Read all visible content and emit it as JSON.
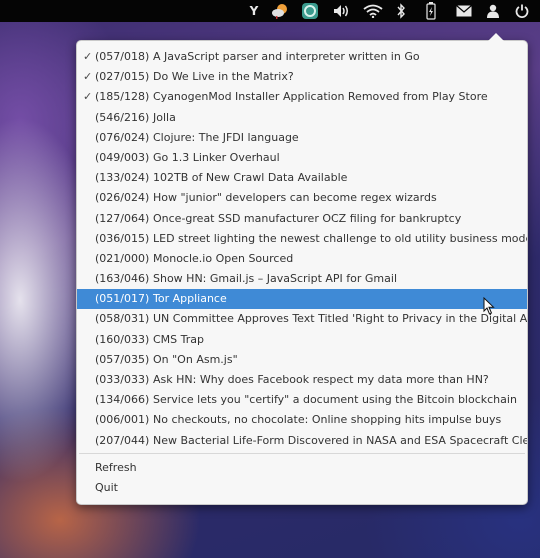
{
  "menu": {
    "items": [
      {
        "checked": true,
        "counts": "(057/018)",
        "title": "A JavaScript parser and interpreter written in Go"
      },
      {
        "checked": true,
        "counts": "(027/015)",
        "title": "Do We Live in the Matrix?"
      },
      {
        "checked": true,
        "counts": "(185/128)",
        "title": "CyanogenMod Installer Application Removed from Play Store"
      },
      {
        "checked": false,
        "counts": "(546/216)",
        "title": "Jolla"
      },
      {
        "checked": false,
        "counts": "(076/024)",
        "title": "Clojure: The JFDI language"
      },
      {
        "checked": false,
        "counts": "(049/003)",
        "title": "Go 1.3 Linker Overhaul"
      },
      {
        "checked": false,
        "counts": "(133/024)",
        "title": "102TB of New Crawl Data Available"
      },
      {
        "checked": false,
        "counts": "(026/024)",
        "title": "How \"junior\" developers can become regex wizards"
      },
      {
        "checked": false,
        "counts": "(127/064)",
        "title": "Once-great SSD manufacturer OCZ filing for bankruptcy"
      },
      {
        "checked": false,
        "counts": "(036/015)",
        "title": "LED street lighting the newest challenge to old utility business models"
      },
      {
        "checked": false,
        "counts": "(021/000)",
        "title": "Monocle.io Open Sourced"
      },
      {
        "checked": false,
        "counts": "(163/046)",
        "title": "Show HN: Gmail.js – JavaScript API for Gmail"
      },
      {
        "checked": false,
        "counts": "(051/017)",
        "title": "Tor Appliance",
        "highlighted": true
      },
      {
        "checked": false,
        "counts": "(058/031)",
        "title": "UN Committee Approves Text Titled 'Right to Privacy in the Digital Age'"
      },
      {
        "checked": false,
        "counts": "(160/033)",
        "title": "CMS Trap"
      },
      {
        "checked": false,
        "counts": "(057/035)",
        "title": "On \"On Asm.js\""
      },
      {
        "checked": false,
        "counts": "(033/033)",
        "title": "Ask HN: Why does Facebook respect my data more than HN?"
      },
      {
        "checked": false,
        "counts": "(134/066)",
        "title": "Service lets you \"certify\" a document using the Bitcoin blockchain"
      },
      {
        "checked": false,
        "counts": "(006/001)",
        "title": "No checkouts, no chocolate: Online shopping hits impulse buys"
      },
      {
        "checked": false,
        "counts": "(207/044)",
        "title": "New Bacterial Life-Form Discovered in NASA and ESA Spacecraft Clean Rooms"
      }
    ],
    "refresh_label": "Refresh",
    "quit_label": "Quit"
  },
  "topbar": {
    "hn_indicator_label": "Y",
    "icons": [
      "hacker-news-indicator-icon",
      "weather-icon",
      "app-indicator-icon",
      "volume-icon",
      "wifi-icon",
      "bluetooth-icon",
      "battery-icon",
      "mail-icon",
      "user-icon",
      "power-icon"
    ]
  },
  "colors": {
    "highlight": "#3f8ad6",
    "menu_bg": "#f7f7f7",
    "topbar_bg": "#050505"
  }
}
